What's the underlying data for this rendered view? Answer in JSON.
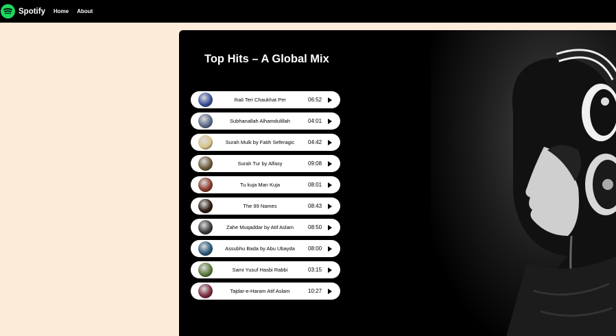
{
  "nav": {
    "brand": "Spotify",
    "links": [
      "Home",
      "About"
    ]
  },
  "main": {
    "title": "Top Hits – A Global Mix"
  },
  "songs": [
    {
      "name": "Ihali Teri Chaukhat Per",
      "duration": "06:52",
      "cover_color": "#3b4f9a"
    },
    {
      "name": "Subhanallah Alhamdulillah",
      "duration": "04:01",
      "cover_color": "#5a6a8a"
    },
    {
      "name": "Surah Mulk by Fatih Seferagic",
      "duration": "04:42",
      "cover_color": "#d9c48a"
    },
    {
      "name": "Surah Tur by Alfasy",
      "duration": "09:08",
      "cover_color": "#6b5a3a"
    },
    {
      "name": "Tu kuja Man Kuja",
      "duration": "08:01",
      "cover_color": "#8a3a2a"
    },
    {
      "name": "The 99 Names",
      "duration": "08:43",
      "cover_color": "#2a1a10"
    },
    {
      "name": "Zahe Muqaddar by Atif Aslam",
      "duration": "08:50",
      "cover_color": "#3a3a3a"
    },
    {
      "name": "Assubhu Bada by Abu Ubayda",
      "duration": "08:00",
      "cover_color": "#2a5a7a"
    },
    {
      "name": "Sami Yusuf Hasbi Rabbi",
      "duration": "03:15",
      "cover_color": "#5a7a3a"
    },
    {
      "name": "Tajdar-e-Haram Atif Aslam",
      "duration": "10:27",
      "cover_color": "#7a2a3a"
    }
  ],
  "icons": {
    "logo": "spotify-logo-icon",
    "play": "play-icon"
  },
  "colors": {
    "page_bg": "#fbebd8",
    "brand_green": "#1ed760",
    "panel_bg": "#000000"
  }
}
